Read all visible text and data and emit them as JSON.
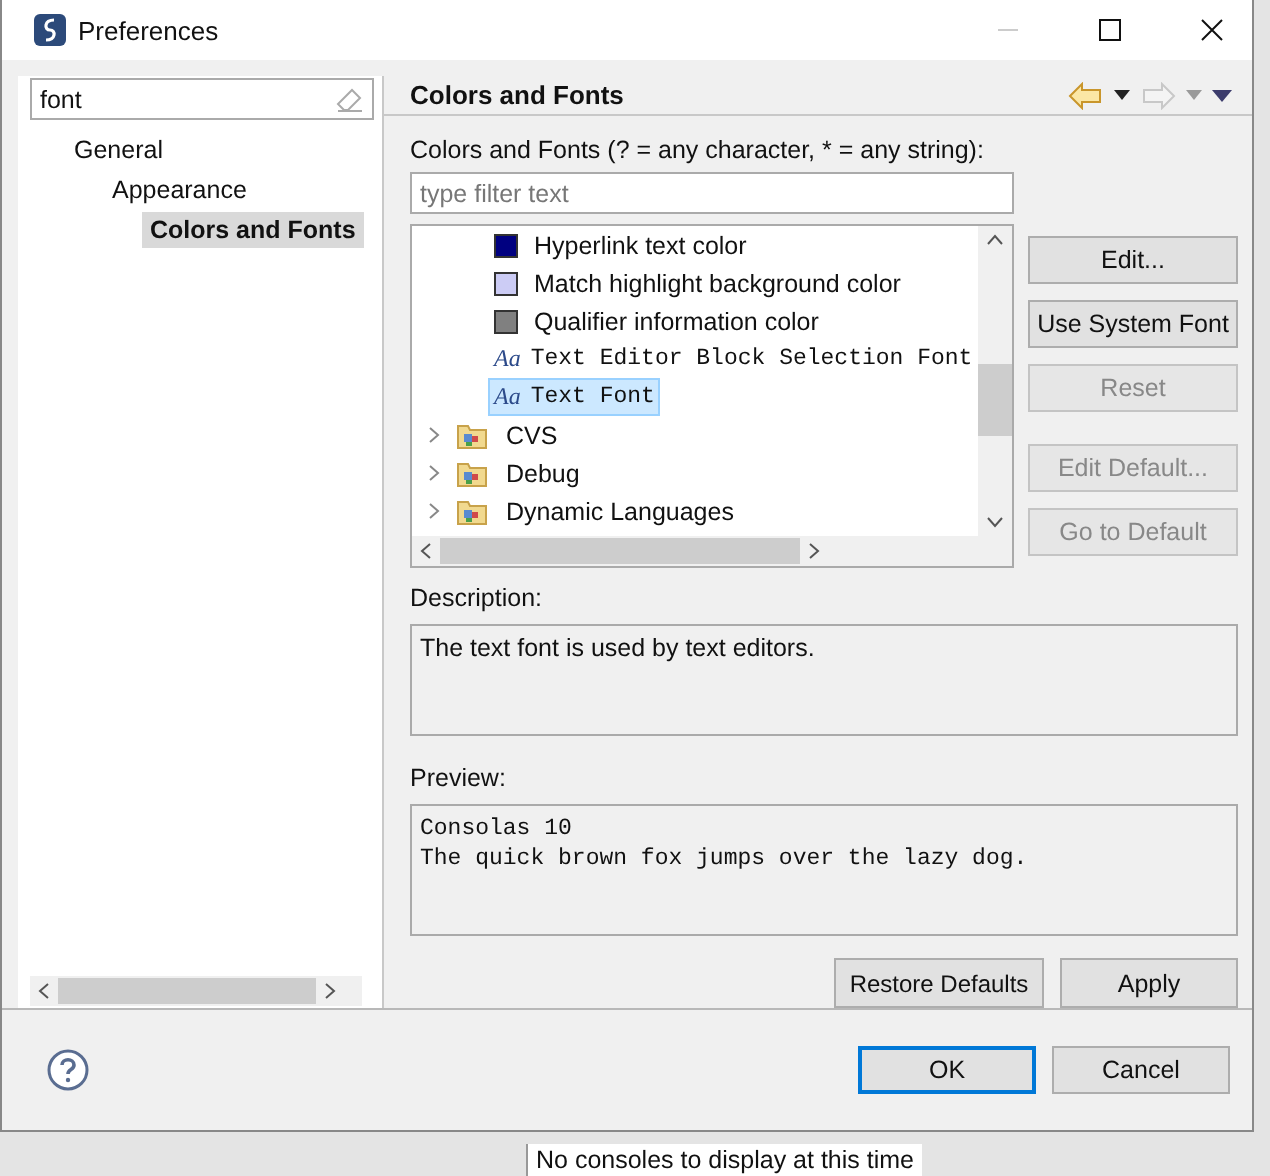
{
  "window": {
    "title": "Preferences"
  },
  "search": {
    "value": "font"
  },
  "nav_tree": [
    {
      "label": "General",
      "selected": false,
      "children": [
        {
          "label": "Appearance",
          "selected": false,
          "children": [
            {
              "label": "Colors and Fonts",
              "selected": true
            }
          ]
        }
      ]
    }
  ],
  "page": {
    "title": "Colors and Fonts",
    "filter_label": "Colors and Fonts (? = any character, * = any string):",
    "filter": {
      "placeholder": "type filter text"
    },
    "items": [
      {
        "kind": "color",
        "label": "Hyperlink text color",
        "color": "#000080",
        "selected": false
      },
      {
        "kind": "color",
        "label": "Match highlight background color",
        "color": "#ccccf5",
        "selected": false
      },
      {
        "kind": "color",
        "label": "Qualifier information color",
        "color": "#808080",
        "selected": false
      },
      {
        "kind": "font",
        "icon": "Aa",
        "label": "Text Editor Block Selection Font",
        "selected": false
      },
      {
        "kind": "font",
        "icon": "Aa",
        "label": "Text Font",
        "selected": true
      },
      {
        "kind": "category",
        "label": "CVS",
        "selected": false
      },
      {
        "kind": "category",
        "label": "Debug",
        "selected": false
      },
      {
        "kind": "category",
        "label": "Dynamic Languages",
        "selected": false
      }
    ],
    "side_buttons": [
      {
        "label": "Edit...",
        "disabled": false
      },
      {
        "label": "Use System Font",
        "disabled": false
      },
      {
        "label": "Reset",
        "disabled": true
      },
      {
        "label": "Edit Default...",
        "disabled": true
      },
      {
        "label": "Go to Default",
        "disabled": true
      }
    ],
    "description_label": "Description:",
    "description": "The text font is used by text editors.",
    "preview_label": "Preview:",
    "preview": [
      "Consolas 10",
      "The quick brown fox jumps over the lazy dog."
    ],
    "buttons": [
      "Restore Defaults",
      "Apply"
    ]
  },
  "dialog_buttons": [
    {
      "label": "OK",
      "default": true
    },
    {
      "label": "Cancel",
      "default": false
    }
  ],
  "background_text": "No consoles to display at this time"
}
